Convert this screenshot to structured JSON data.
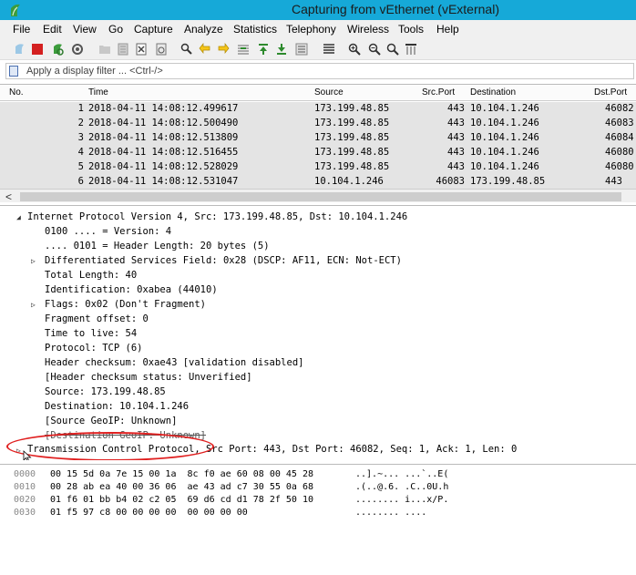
{
  "window": {
    "title": "Capturing from vEthernet (vExternal)"
  },
  "menu": [
    "File",
    "Edit",
    "View",
    "Go",
    "Capture",
    "Analyze",
    "Statistics",
    "Telephony",
    "Wireless",
    "Tools",
    "Help"
  ],
  "filter": {
    "placeholder": "Apply a display filter ... <Ctrl-/>"
  },
  "packet_list": {
    "columns": {
      "no": "No.",
      "time": "Time",
      "source": "Source",
      "src_port": "Src.Port",
      "destination": "Destination",
      "dst_port": "Dst.Port"
    },
    "rows": [
      {
        "no": "1",
        "time": "2018-04-11 14:08:12.499617",
        "source": "173.199.48.85",
        "src_port": "443",
        "destination": "10.104.1.246",
        "dst_port": "46082"
      },
      {
        "no": "2",
        "time": "2018-04-11 14:08:12.500490",
        "source": "173.199.48.85",
        "src_port": "443",
        "destination": "10.104.1.246",
        "dst_port": "46083"
      },
      {
        "no": "3",
        "time": "2018-04-11 14:08:12.513809",
        "source": "173.199.48.85",
        "src_port": "443",
        "destination": "10.104.1.246",
        "dst_port": "46084"
      },
      {
        "no": "4",
        "time": "2018-04-11 14:08:12.516455",
        "source": "173.199.48.85",
        "src_port": "443",
        "destination": "10.104.1.246",
        "dst_port": "46080"
      },
      {
        "no": "5",
        "time": "2018-04-11 14:08:12.528029",
        "source": "173.199.48.85",
        "src_port": "443",
        "destination": "10.104.1.246",
        "dst_port": "46080"
      },
      {
        "no": "6",
        "time": "2018-04-11 14:08:12.531047",
        "source": "10.104.1.246",
        "src_port": "46083",
        "destination": "173.199.48.85",
        "dst_port": "443"
      }
    ]
  },
  "details": {
    "lines": [
      "Internet Protocol Version 4, Src: 173.199.48.85, Dst: 10.104.1.246",
      "0100 .... = Version: 4",
      ".... 0101 = Header Length: 20 bytes (5)",
      "Differentiated Services Field: 0x28 (DSCP: AF11, ECN: Not-ECT)",
      "Total Length: 40",
      "Identification: 0xabea (44010)",
      "Flags: 0x02 (Don't Fragment)",
      "Fragment offset: 0",
      "Time to live: 54",
      "Protocol: TCP (6)",
      "Header checksum: 0xae43 [validation disabled]",
      "[Header checksum status: Unverified]",
      "Source: 173.199.48.85",
      "Destination: 10.104.1.246",
      "[Source GeoIP: Unknown]",
      "[Destination GeoIP: Unknown]",
      "Transmission Control Protocol, Src Port: 443, Dst Port: 46082, Seq: 1, Ack: 1, Len: 0"
    ]
  },
  "bytes": {
    "rows": [
      {
        "offset": "0000",
        "hex": "00 15 5d 0a 7e 15 00 1a  8c f0 ae 60 08 00 45 28",
        "ascii": "..].~... ...`..E("
      },
      {
        "offset": "0010",
        "hex": "00 28 ab ea 40 00 36 06  ae 43 ad c7 30 55 0a 68",
        "ascii": ".(..@.6. .C..0U.h"
      },
      {
        "offset": "0020",
        "hex": "01 f6 01 bb b4 02 c2 05  69 d6 cd d1 78 2f 50 10",
        "ascii": "........ i...x/P."
      },
      {
        "offset": "0030",
        "hex": "01 f5 97 c8 00 00 00 00  00 00 00 00",
        "ascii": "........ ...."
      }
    ]
  },
  "colors": {
    "titlebar": "#16a9d8",
    "row_bg": "#e4e4e4",
    "highlight_ring": "#e02020"
  }
}
